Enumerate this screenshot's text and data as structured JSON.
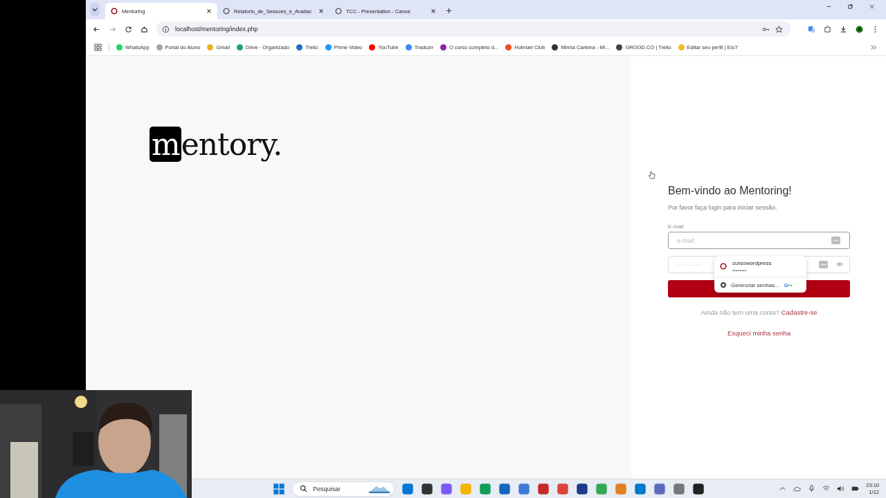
{
  "tabs": [
    {
      "title": "Mentoring",
      "selected": true
    },
    {
      "title": "Relatorio_de_Sessoes_e_Avaliac",
      "selected": false
    },
    {
      "title": "TCC - Presentation - Canva",
      "selected": false
    }
  ],
  "address": "localhost/mentoring/index.php",
  "bookmarks": [
    {
      "label": "WhatsApp",
      "color": "#25d366"
    },
    {
      "label": "Portal do Aluno",
      "color": "#9aa7b5"
    },
    {
      "label": "Gmail",
      "color": "#e8b422"
    },
    {
      "label": "Drive · Organizado",
      "color": "#1fa463"
    },
    {
      "label": "Trello",
      "color": "#1f6fc5"
    },
    {
      "label": "Prime Video",
      "color": "#1a98ff"
    },
    {
      "label": "YouTube",
      "color": "#ff0000"
    },
    {
      "label": "Traduzir",
      "color": "#4285f4"
    },
    {
      "label": "O curso completo d...",
      "color": "#8e24aa"
    },
    {
      "label": "Hotmart Club",
      "color": "#f04e23"
    },
    {
      "label": "Minha Carteira - Mi...",
      "color": "#333333"
    },
    {
      "label": "GROOD.CO | Trello",
      "color": "#444444"
    },
    {
      "label": "Editar seu perfil | Elo7",
      "color": "#f5b82e"
    }
  ],
  "logo": {
    "highlight": "m",
    "rest": "entory."
  },
  "login": {
    "title": "Bem-vindo ao Mentoring!",
    "subtitle": "Por favor faça login para iniciar sessão.",
    "email_label": "E-mail",
    "email_placeholder": "e-mail",
    "password_placeholder": "············",
    "signup_prompt": "Ainda não tem uma conta?",
    "signup_link": "Cadastre-se",
    "forgot_link": "Esqueci minha senha"
  },
  "autofill": {
    "username": "cursowordpress",
    "password": "••••••••",
    "manage": "Gerenciar senhas..."
  },
  "taskbar": {
    "search_placeholder": "Pesquisar",
    "time": "23:10",
    "date": "1/12"
  }
}
